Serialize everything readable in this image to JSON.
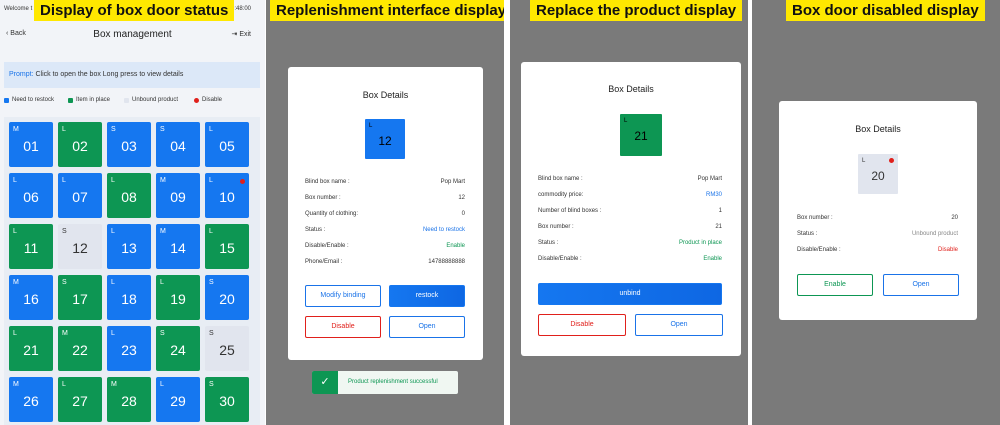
{
  "captions": {
    "p1": "Display of box door status",
    "p2": "Replenishment interface display",
    "p3": "Replace the product display",
    "p4": "Box door disabled display"
  },
  "statusbar": {
    "welcome": "Welcome t",
    "time": "19:48:00"
  },
  "nav": {
    "back": "Back",
    "title": "Box management",
    "exit": "Exit"
  },
  "prompt": {
    "label": "Prompt:",
    "text": "Click to open the box    Long press to view details"
  },
  "legend": [
    {
      "label": "Need to restock",
      "color": "#1577f0"
    },
    {
      "label": "Item in place",
      "color": "#0d9653"
    },
    {
      "label": "Unbound product",
      "color": "#e1e5ee"
    },
    {
      "label": "Disable",
      "color": "#e0201b"
    }
  ],
  "cells": [
    {
      "size": "M",
      "num": "01",
      "state": "blue"
    },
    {
      "size": "L",
      "num": "02",
      "state": "green"
    },
    {
      "size": "S",
      "num": "03",
      "state": "blue"
    },
    {
      "size": "S",
      "num": "04",
      "state": "blue"
    },
    {
      "size": "L",
      "num": "05",
      "state": "blue"
    },
    {
      "size": "L",
      "num": "06",
      "state": "blue"
    },
    {
      "size": "L",
      "num": "07",
      "state": "blue"
    },
    {
      "size": "L",
      "num": "08",
      "state": "green"
    },
    {
      "size": "M",
      "num": "09",
      "state": "blue"
    },
    {
      "size": "L",
      "num": "10",
      "state": "blue",
      "disabled": true
    },
    {
      "size": "L",
      "num": "11",
      "state": "green"
    },
    {
      "size": "S",
      "num": "12",
      "state": "gray"
    },
    {
      "size": "L",
      "num": "13",
      "state": "blue"
    },
    {
      "size": "M",
      "num": "14",
      "state": "blue"
    },
    {
      "size": "L",
      "num": "15",
      "state": "green"
    },
    {
      "size": "M",
      "num": "16",
      "state": "blue"
    },
    {
      "size": "S",
      "num": "17",
      "state": "green"
    },
    {
      "size": "L",
      "num": "18",
      "state": "blue"
    },
    {
      "size": "L",
      "num": "19",
      "state": "green"
    },
    {
      "size": "S",
      "num": "20",
      "state": "blue"
    },
    {
      "size": "L",
      "num": "21",
      "state": "green"
    },
    {
      "size": "M",
      "num": "22",
      "state": "green"
    },
    {
      "size": "L",
      "num": "23",
      "state": "blue"
    },
    {
      "size": "S",
      "num": "24",
      "state": "green"
    },
    {
      "size": "S",
      "num": "25",
      "state": "gray"
    },
    {
      "size": "M",
      "num": "26",
      "state": "blue"
    },
    {
      "size": "L",
      "num": "27",
      "state": "green"
    },
    {
      "size": "M",
      "num": "28",
      "state": "green"
    },
    {
      "size": "L",
      "num": "29",
      "state": "blue"
    },
    {
      "size": "S",
      "num": "30",
      "state": "green"
    }
  ],
  "card2": {
    "title": "Box Details",
    "box": {
      "size": "L",
      "num": "12"
    },
    "rows": [
      {
        "label": "Blind box name :",
        "value": "Pop Mart",
        "tone": ""
      },
      {
        "label": "Box number :",
        "value": "12",
        "tone": ""
      },
      {
        "label": "Quantity of clothing:",
        "value": "0",
        "tone": ""
      },
      {
        "label": "Status :",
        "value": "Need to restock",
        "tone": "blue"
      },
      {
        "label": "Disable/Enable :",
        "value": "Enable",
        "tone": "green"
      },
      {
        "label": "Phone/Email :",
        "value": "14788888888",
        "tone": ""
      }
    ],
    "modify_label": "Modify binding",
    "restock_label": "restock",
    "disable_label": "Disable",
    "open_label": "Open"
  },
  "toast": {
    "check": "✓",
    "message": "Product replenishment successful"
  },
  "card3": {
    "title": "Box Details",
    "box": {
      "size": "L",
      "num": "21"
    },
    "rows": [
      {
        "label": "Blind box name :",
        "value": "Pop Mart",
        "tone": ""
      },
      {
        "label": "commodity price:",
        "value": "RM30",
        "tone": "blue"
      },
      {
        "label": "Number of blind boxes :",
        "value": "1",
        "tone": ""
      },
      {
        "label": "Box number :",
        "value": "21",
        "tone": ""
      },
      {
        "label": "Status :",
        "value": "Product in place",
        "tone": "green"
      },
      {
        "label": "Disable/Enable :",
        "value": "Enable",
        "tone": "green"
      }
    ],
    "unbind_label": "unbind",
    "disable_label": "Disable",
    "open_label": "Open"
  },
  "card4": {
    "title": "Box Details",
    "box": {
      "size": "L",
      "num": "20"
    },
    "rows": [
      {
        "label": "Box number :",
        "value": "20",
        "tone": ""
      },
      {
        "label": "Status :",
        "value": "Unbound product",
        "tone": "muted"
      },
      {
        "label": "Disable/Enable :",
        "value": "Disable",
        "tone": "red"
      }
    ],
    "enable_label": "Enable",
    "open_label": "Open"
  }
}
